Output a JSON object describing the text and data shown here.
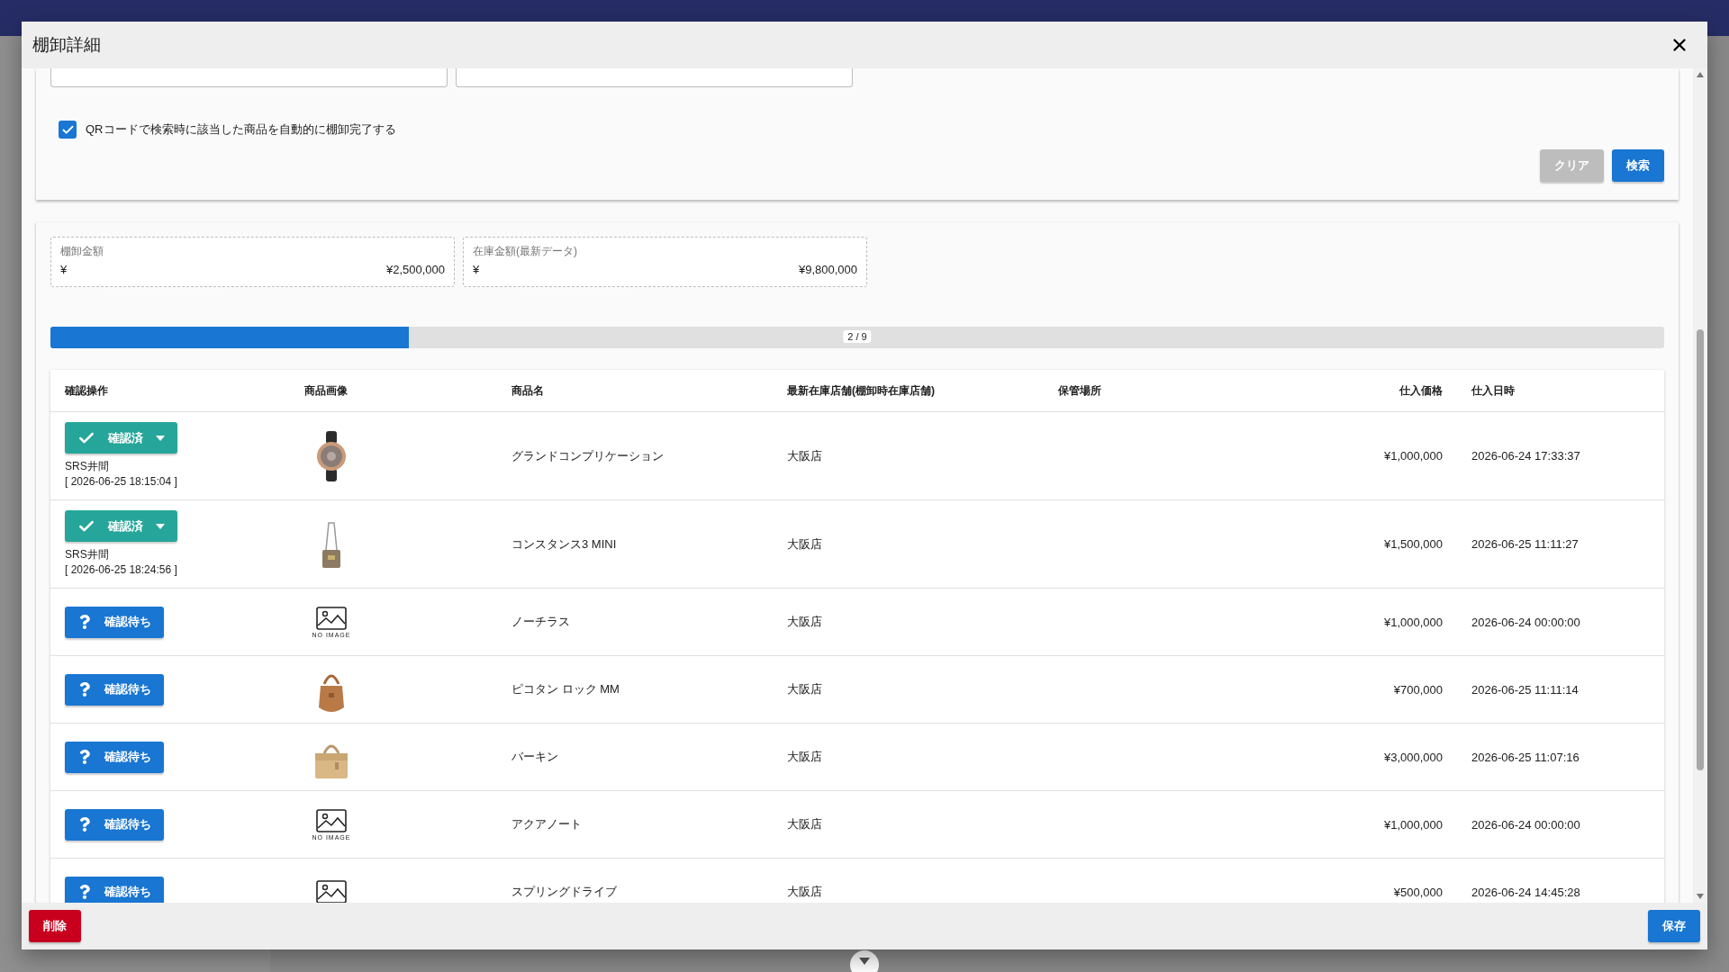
{
  "dialog": {
    "title": "棚卸詳細"
  },
  "search": {
    "fields": [
      {
        "kind": "input"
      },
      {
        "kind": "input"
      }
    ],
    "auto_complete": {
      "label": "QRコードで検索時に該当した商品を自動的に棚卸完了する",
      "checked": true
    },
    "buttons": [
      {
        "label": "クリア",
        "kind": "secondary"
      },
      {
        "label": "検索",
        "kind": "primary"
      }
    ]
  },
  "summary": [
    {
      "label": "棚卸金額",
      "currency": "¥",
      "value": "¥2,500,000"
    },
    {
      "label": "在庫金額(最新データ)",
      "currency": "¥",
      "value": "¥9,800,000"
    }
  ],
  "progress": {
    "level": 0.222,
    "label": "2 / 9"
  },
  "table": {
    "columns": [
      "確認操作",
      "商品画像",
      "商品名",
      "最新在庫店舗(棚卸時在庫店舗)",
      "保管場所",
      "仕入価格",
      "仕入日時"
    ],
    "rows": [
      {
        "confirmed": true,
        "status_label": "確認済",
        "confirmed_by": "SRS井間",
        "confirmed_at": "[ 2026-06-25 18:15:04 ]",
        "image": {
          "kind": "watch"
        },
        "name": "グランドコンプリケーション",
        "store": "大阪店",
        "price": "¥1,000,000",
        "purchased_at": "2026-06-24 17:33:37"
      },
      {
        "confirmed": true,
        "status_label": "確認済",
        "confirmed_by": "SRS井間",
        "confirmed_at": "[ 2026-06-25 18:24:56 ]",
        "image": {
          "kind": "shoulder_bag"
        },
        "name": "コンスタンス3 MINI",
        "store": "大阪店",
        "price": "¥1,500,000",
        "purchased_at": "2026-06-25 11:11:27"
      },
      {
        "confirmed": false,
        "status_label": "確認待ち",
        "image": {
          "kind": "no_image",
          "caption": "NO IMAGE"
        },
        "name": "ノーチラス",
        "store": "大阪店",
        "price": "¥1,000,000",
        "purchased_at": "2026-06-24 00:00:00"
      },
      {
        "confirmed": false,
        "status_label": "確認待ち",
        "image": {
          "kind": "tote_bag"
        },
        "name": "ピコタン ロック MM",
        "store": "大阪店",
        "price": "¥700,000",
        "purchased_at": "2026-06-25 11:11:14"
      },
      {
        "confirmed": false,
        "status_label": "確認待ち",
        "image": {
          "kind": "handbag"
        },
        "name": "バーキン",
        "store": "大阪店",
        "price": "¥3,000,000",
        "purchased_at": "2026-06-25 11:07:16"
      },
      {
        "confirmed": false,
        "status_label": "確認待ち",
        "image": {
          "kind": "no_image",
          "caption": "NO IMAGE"
        },
        "name": "アクアノート",
        "store": "大阪店",
        "price": "¥1,000,000",
        "purchased_at": "2026-06-24 00:00:00"
      },
      {
        "confirmed": false,
        "status_label": "確認待ち",
        "image": {
          "kind": "no_image"
        },
        "name": "スプリングドライブ",
        "store": "大阪店",
        "price": "¥500,000",
        "purchased_at": "2026-06-24 14:45:28"
      }
    ]
  },
  "footer": {
    "buttons": [
      {
        "label": "削除",
        "kind": "danger"
      },
      {
        "label": "保存",
        "kind": "primary"
      }
    ]
  }
}
